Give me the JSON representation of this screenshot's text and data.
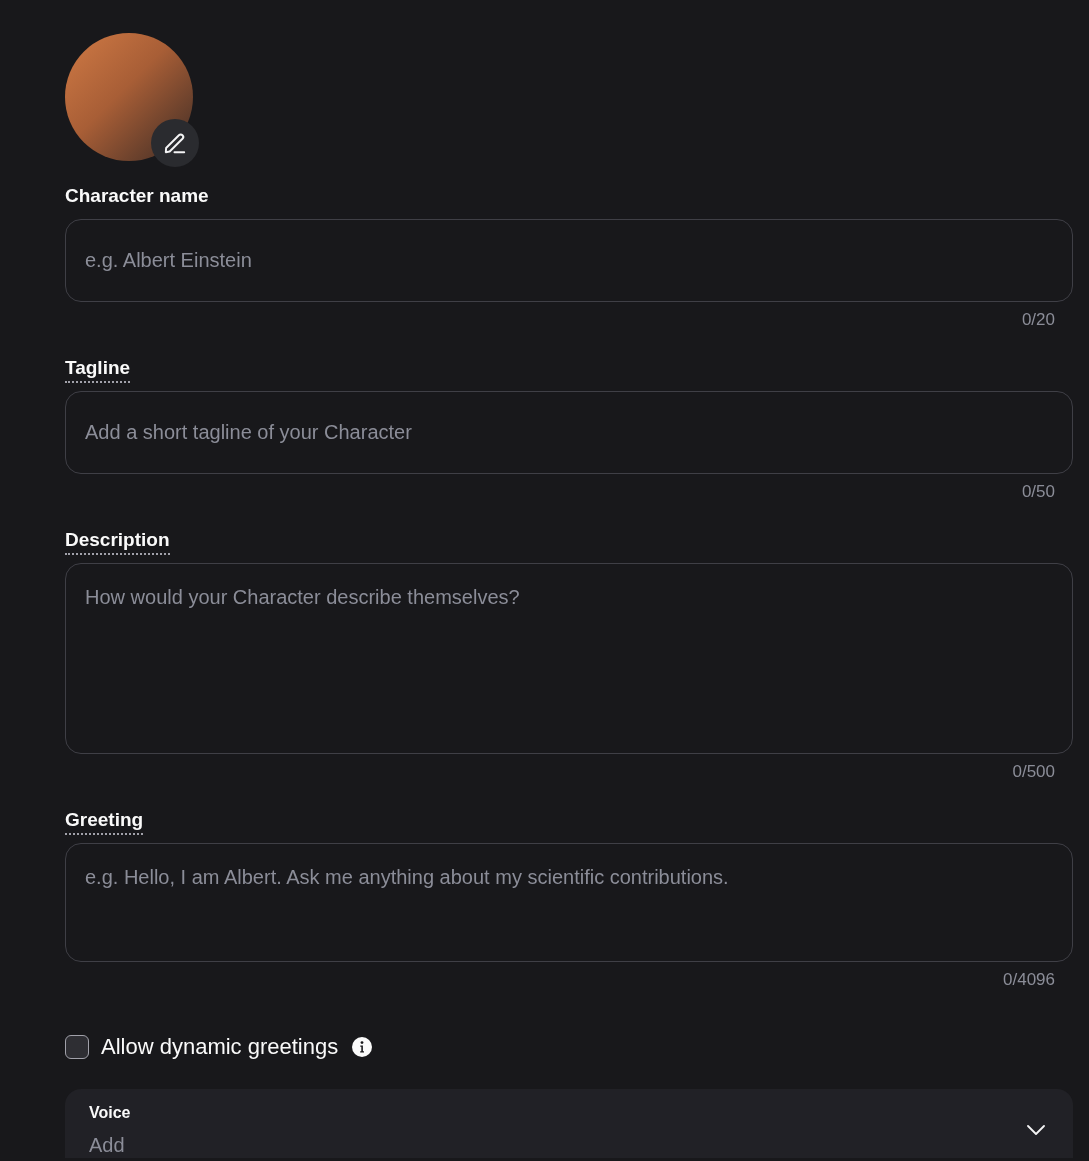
{
  "fields": [
    {
      "kind": "input",
      "label": "Character name",
      "has_tooltip": false,
      "placeholder": "e.g. Albert Einstein",
      "counter": "0/20"
    },
    {
      "kind": "input",
      "label": "Tagline",
      "has_tooltip": true,
      "placeholder": "Add a short tagline of your Character",
      "counter": "0/50"
    },
    {
      "kind": "tall-textarea",
      "label": "Description",
      "has_tooltip": true,
      "placeholder": "How would your Character describe themselves?",
      "counter": "0/500"
    },
    {
      "kind": "textarea",
      "label": "Greeting",
      "has_tooltip": true,
      "placeholder": "e.g. Hello, I am Albert. Ask me anything about my scientific contributions.",
      "counter": "0/4096"
    }
  ],
  "dynamic_greetings": {
    "label": "Allow dynamic greetings",
    "checked": false
  },
  "voice": {
    "label": "Voice",
    "placeholder": "Add"
  }
}
